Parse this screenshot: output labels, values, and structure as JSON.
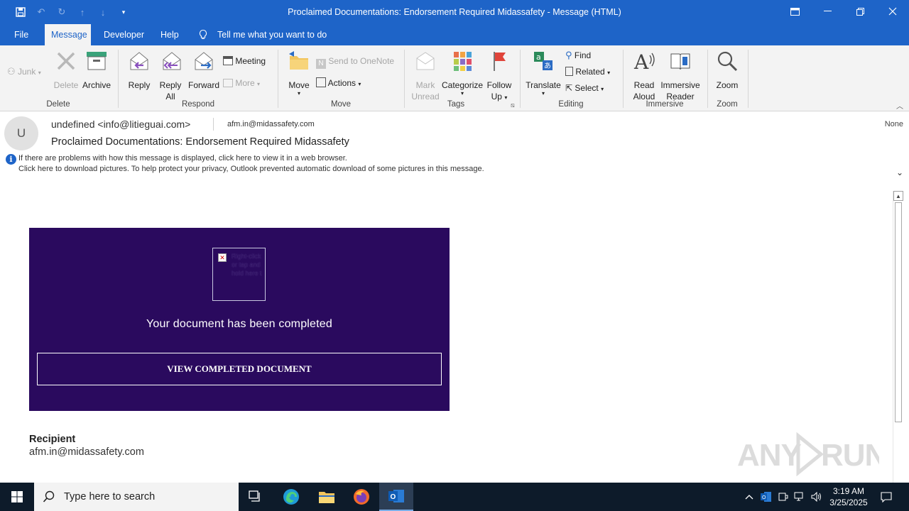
{
  "window": {
    "title": "Proclaimed Documentations: Endorsement Required Midassafety  -  Message (HTML)"
  },
  "menu_tabs": [
    {
      "label": "File"
    },
    {
      "label": "Message"
    },
    {
      "label": "Developer"
    },
    {
      "label": "Help"
    }
  ],
  "tell_me": "Tell me what you want to do",
  "ribbon": {
    "delete_group": {
      "label": "Delete",
      "junk": "Junk",
      "delete": "Delete",
      "archive": "Archive"
    },
    "respond_group": {
      "label": "Respond",
      "reply": "Reply",
      "reply_all_1": "Reply",
      "reply_all_2": "All",
      "forward": "Forward",
      "meeting": "Meeting",
      "more": "More"
    },
    "move_group": {
      "label": "Move",
      "move": "Move",
      "send_onenote": "Send to OneNote",
      "actions": "Actions"
    },
    "tags_group": {
      "label": "Tags",
      "mark_unread_1": "Mark",
      "mark_unread_2": "Unread",
      "categorize": "Categorize",
      "follow_up_1": "Follow",
      "follow_up_2": "Up"
    },
    "editing_group": {
      "label": "Editing",
      "translate": "Translate",
      "find": "Find",
      "related": "Related",
      "select": "Select"
    },
    "immersive_group": {
      "label": "Immersive",
      "read_aloud_1": "Read",
      "read_aloud_2": "Aloud",
      "immersive_reader_1": "Immersive",
      "immersive_reader_2": "Reader"
    },
    "zoom_group": {
      "label": "Zoom",
      "zoom": "Zoom"
    }
  },
  "message": {
    "avatar_initial": "U",
    "from": "undefined <info@litieguai.com>",
    "to": "afm.in@midassafety.com",
    "retention": "None",
    "subject": "Proclaimed Documentations: Endorsement Required Midassafety",
    "info_line_1": "If there are problems with how this message is displayed, click here to view it in a web browser.",
    "info_line_2": "Click here to download pictures. To help protect your privacy, Outlook prevented automatic download of some pictures in this message."
  },
  "body": {
    "image_placeholder_text": "Right-click or tap and hold here t",
    "document_message": "Your document has been completed",
    "view_button": "VIEW COMPLETED DOCUMENT",
    "recipient_label": "Recipient",
    "recipient_value": "afm.in@midassafety.com"
  },
  "watermark": "ANY RUN",
  "taskbar": {
    "search_placeholder": "Type here to search",
    "time": "3:19 AM",
    "date": "3/25/2025"
  },
  "colors": {
    "accent": "#1e64c8",
    "card_bg": "#2a0a5e"
  }
}
